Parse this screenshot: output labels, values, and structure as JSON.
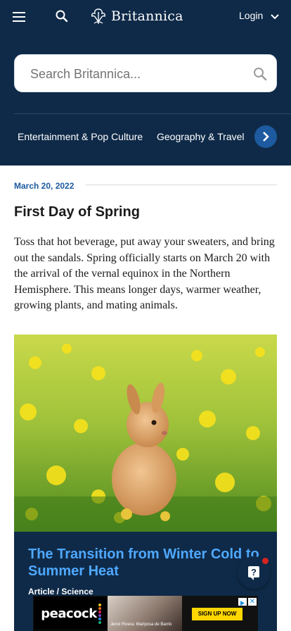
{
  "header": {
    "menu_icon": "hamburger-menu-icon",
    "search_icon": "search-icon",
    "logo_text": "Britannica",
    "login_label": "Login",
    "login_icon": "chevron-down-icon",
    "bg_color": "#0f2a48"
  },
  "search": {
    "placeholder": "Search Britannica...",
    "value": ""
  },
  "categories": [
    {
      "label": "Entertainment & Pop Culture"
    },
    {
      "label": "Geography & Travel"
    }
  ],
  "content": {
    "date": "March 20, 2022",
    "title": "First Day of Spring",
    "intro": "Toss that hot beverage, put away your sweaters, and bring out the sandals. Spring officially starts on March 20 with the arrival of the vernal equinox in the Northern Hemisphere. This means longer days, warmer weather, growing plants, and mating animals.",
    "accent_color": "#1d5aa0"
  },
  "card": {
    "title": "The Transition from Winter Cold to Summer Heat",
    "meta": "Article / Science",
    "title_color": "#4fa8ff"
  },
  "ad": {
    "brand": "peacock",
    "caption": "Jenni Rivera: Mariposa de Barrio",
    "cta": "SIGN UP NOW",
    "close": "✕"
  }
}
